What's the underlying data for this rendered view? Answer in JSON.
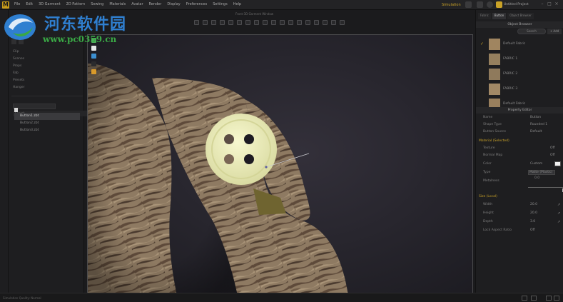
{
  "menu": {
    "app_logo": "M",
    "items": [
      "File",
      "Edit",
      "3D Garment",
      "2D Pattern",
      "Sewing",
      "Materials",
      "Avatar",
      "Render",
      "Display",
      "Preferences",
      "Settings",
      "Help"
    ]
  },
  "topbar": {
    "workspace": "Simulation",
    "user": "Untitled Project"
  },
  "viewport": {
    "title": "Front-3D Garment Window"
  },
  "library": {
    "items": [
      "Clip",
      "Scenes",
      "Props",
      "Fab",
      "Presets",
      "Hanger"
    ],
    "search_placeholder": "Search",
    "files": [
      "Button1.zbt",
      "Button2.zbt",
      "Button3.zbt"
    ],
    "selected_index": 0
  },
  "right_panel": {
    "tabs": [
      "Fabric",
      "Button",
      "Object Browser"
    ],
    "active_tab": 1,
    "header": "Object Browser",
    "search": "Search",
    "add_label": "+ Add",
    "fabrics": [
      {
        "name": "Default Fabric",
        "checked": true
      },
      {
        "name": "FABRIC 1",
        "checked": false
      },
      {
        "name": "FABRIC 2",
        "checked": false
      },
      {
        "name": "FABRIC 3",
        "checked": false
      },
      {
        "name": "Default Fabric",
        "checked": false
      }
    ]
  },
  "property": {
    "header": "Property Editor",
    "rows": [
      {
        "label": "Name",
        "value": "Button"
      },
      {
        "label": "Shape Type",
        "value": "Rounded 1"
      },
      {
        "label": "Button Source",
        "value": "Default"
      }
    ],
    "material_section": "Material (Selected)",
    "material_rows": [
      {
        "label": "Texture",
        "value": "Off"
      },
      {
        "label": "Normal Map",
        "value": "Off"
      },
      {
        "label": "Color",
        "value": "Custom"
      },
      {
        "label": "Type",
        "value": "Matte (Plastic)"
      },
      {
        "label": "Metalness",
        "value": "0.0"
      }
    ],
    "size_section": "Size (Local)",
    "size_rows": [
      {
        "label": "Width",
        "value": "20.0"
      },
      {
        "label": "Height",
        "value": "20.0"
      },
      {
        "label": "Depth",
        "value": "3.0"
      },
      {
        "label": "Lock Aspect Ratio",
        "value": "Off"
      }
    ],
    "metalness_level": 0.95
  },
  "status": {
    "text": "Simulation Quality: Normal"
  },
  "watermark": {
    "title": "河东软件园",
    "url": "www.pc0359.cn"
  },
  "colors": {
    "accent": "#c9a227",
    "watermark_blue": "#2f7fd0",
    "watermark_green": "#3aa845",
    "button": "#ecedb8"
  }
}
